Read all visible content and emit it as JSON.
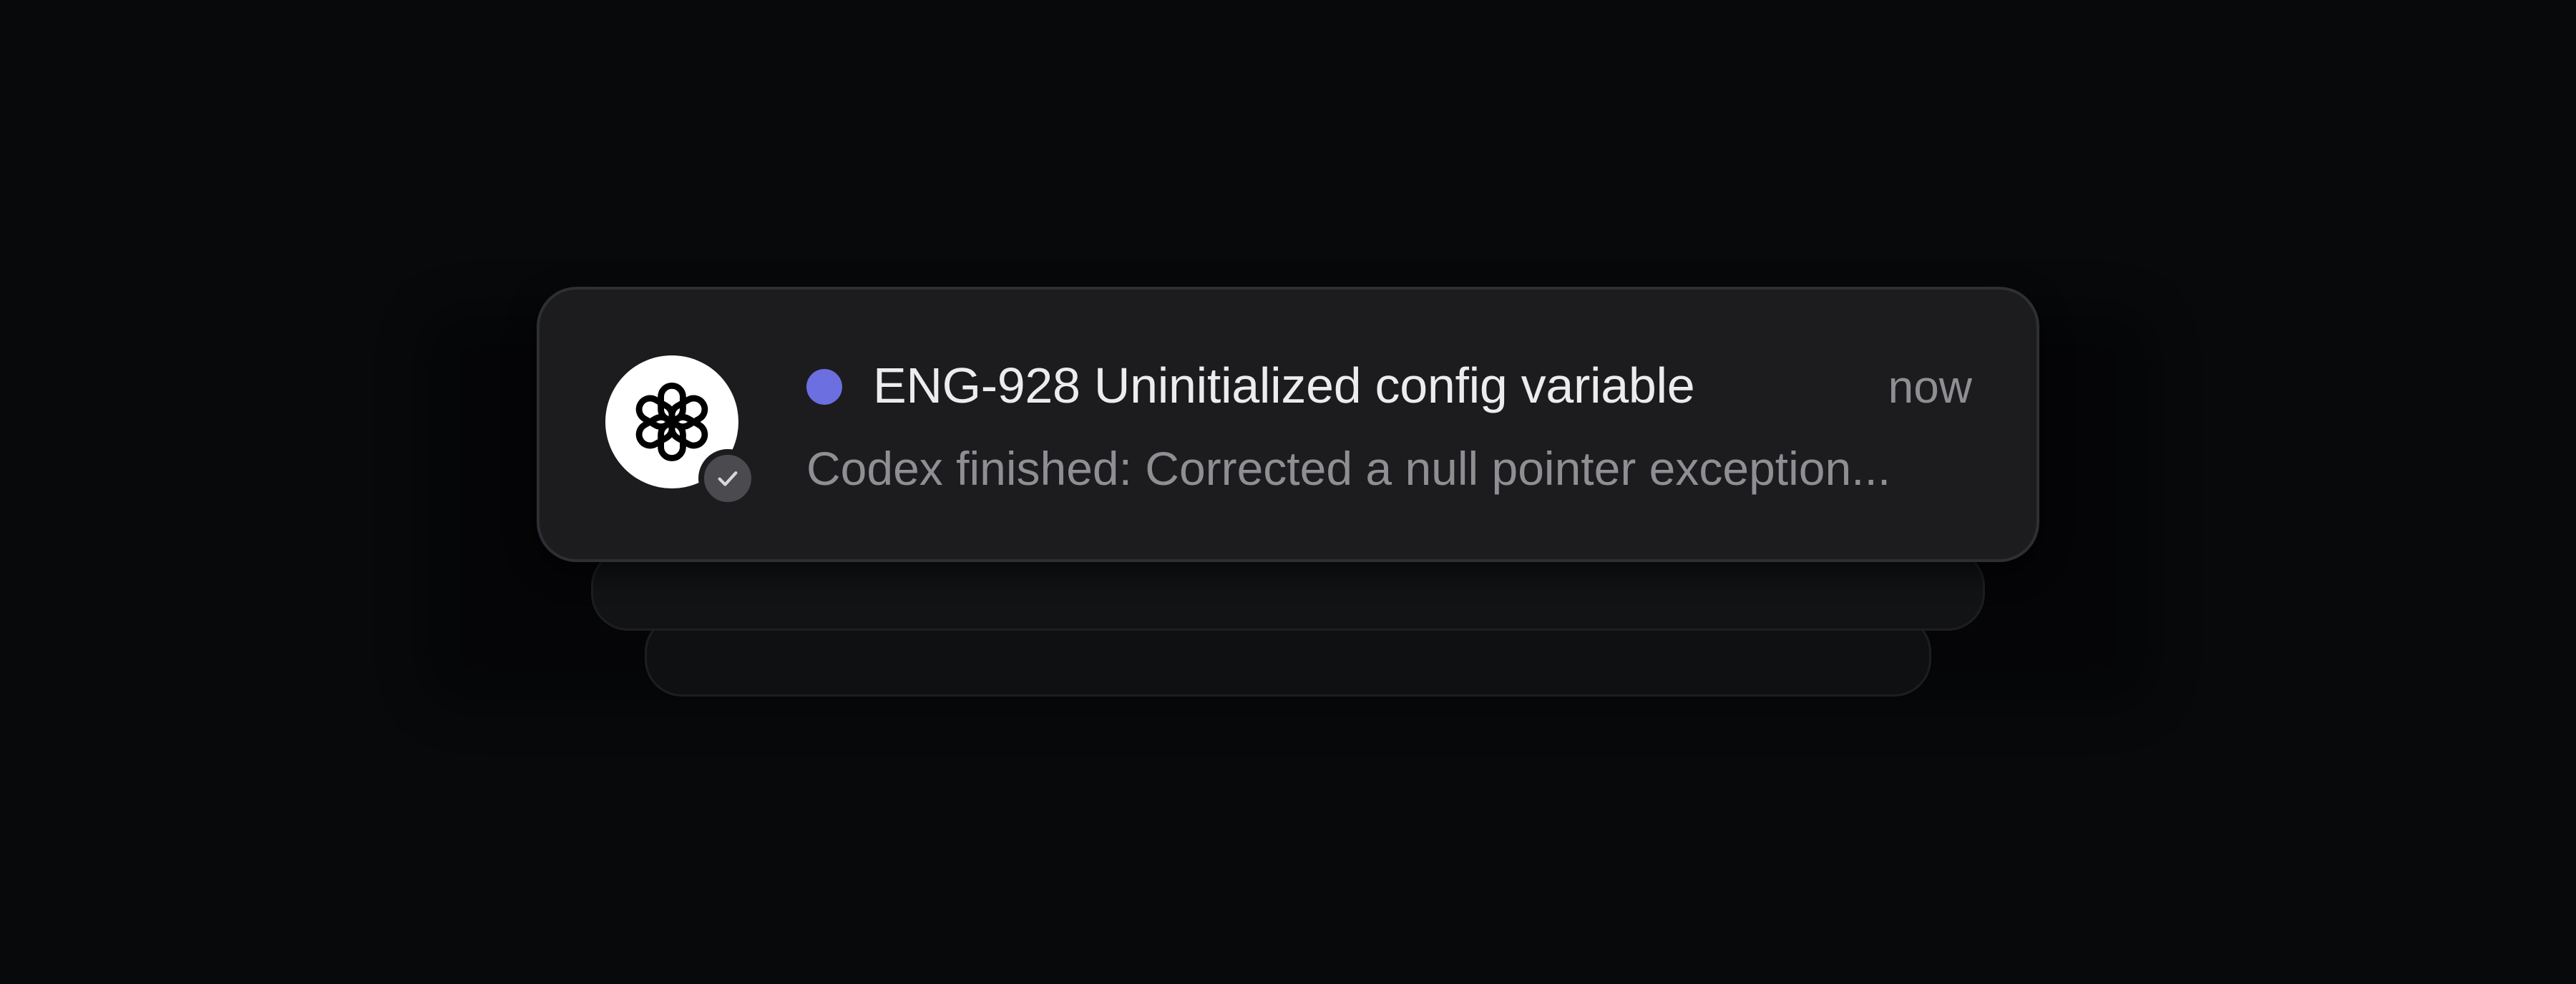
{
  "notification": {
    "title": "ENG-928 Uninitialized config variable",
    "time": "now",
    "body": "Codex finished: Corrected a null pointer exception...",
    "unread_dot_color": "#6b6fe0",
    "app_icon": "openai-logo-icon",
    "status_icon": "checkmark-icon"
  }
}
